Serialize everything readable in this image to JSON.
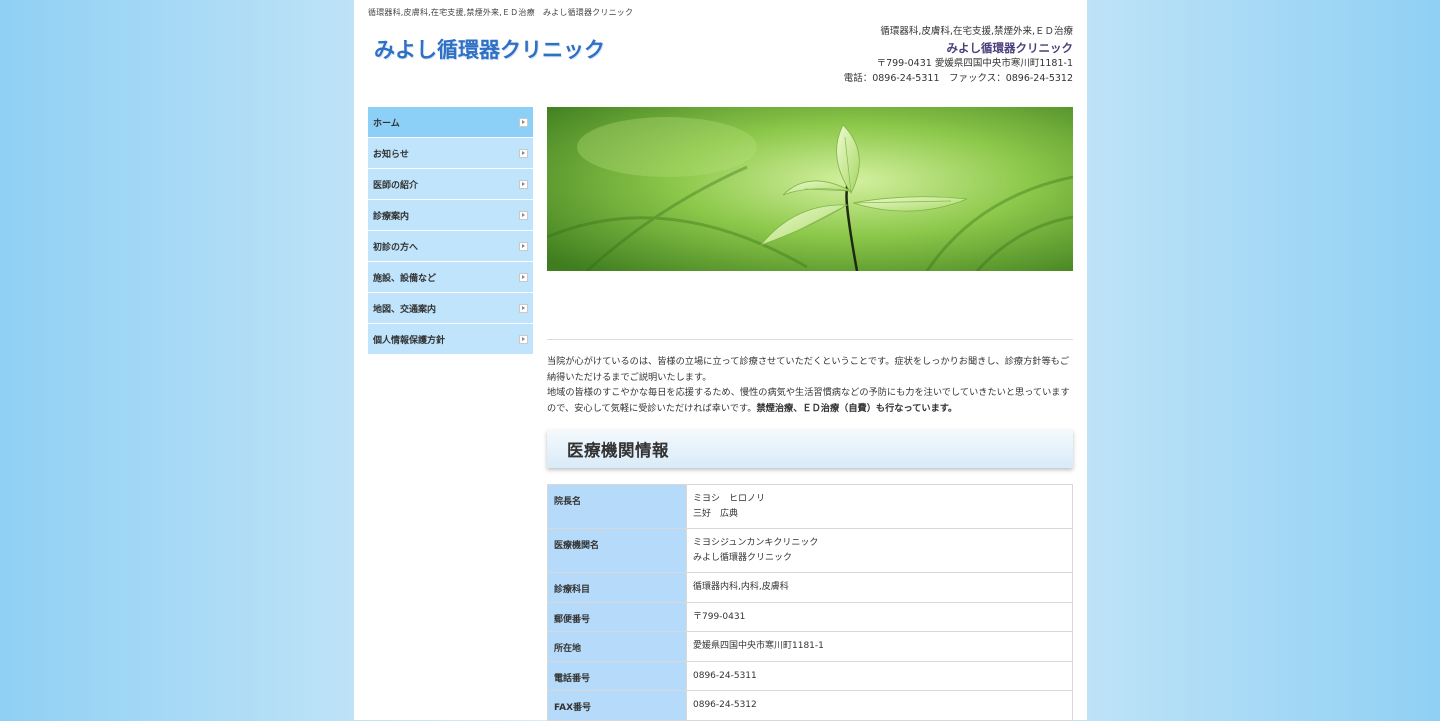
{
  "header": {
    "topline": "循環器科,皮膚科,在宅支援,禁煙外来,ＥＤ治療　みよし循環器クリニック",
    "logo": "みよし循環器クリニック",
    "right_line1": "循環器科,皮膚科,在宅支援,禁煙外来,ＥＤ治療",
    "right_clinic_name": "みよし循環器クリニック",
    "right_address": "〒799-0431 愛媛県四国中央市寒川町1181-1",
    "right_phone": "電話：0896-24-5311　ファックス：0896-24-5312"
  },
  "sidebar": {
    "items": [
      {
        "label": "ホーム"
      },
      {
        "label": "お知らせ"
      },
      {
        "label": "医師の紹介"
      },
      {
        "label": "診療案内"
      },
      {
        "label": "初診の方へ"
      },
      {
        "label": "施設、設備など"
      },
      {
        "label": "地図、交通案内"
      },
      {
        "label": "個人情報保護方針"
      }
    ]
  },
  "main": {
    "intro_1": "当院が心がけているのは、皆様の立場に立って診療させていただくということです。症状をしっかりお聞きし、診療方針等もご納得いただけるまでご説明いたします。",
    "intro_2": "地域の皆様のすこやかな毎日を応援するため、慢性の病気や生活習慣病などの予防にも力を注いでしていきたいと思っていますので、安心して気軽に受診いただければ幸いです。",
    "intro_2_bold": "禁煙治療、ＥＤ治療（自費）も行なっています。",
    "section_title": "医療機関情報",
    "table": [
      {
        "label": "院長名",
        "line1": "ミヨシ　ヒロノリ",
        "line2": "三好　広典"
      },
      {
        "label": "医療機関名",
        "line1": "ミヨシジュンカンキクリニック",
        "line2": "みよし循環器クリニック"
      },
      {
        "label": "診療科目",
        "line1": "循環器内科,内科,皮膚科",
        "line2": ""
      },
      {
        "label": "郵便番号",
        "line1": "〒799-0431",
        "line2": ""
      },
      {
        "label": "所在地",
        "line1": "愛媛県四国中央市寒川町1181-1",
        "line2": ""
      },
      {
        "label": "電話番号",
        "line1": "0896-24-5311",
        "line2": ""
      },
      {
        "label": "FAX番号",
        "line1": "0896-24-5312",
        "line2": ""
      }
    ]
  },
  "colors": {
    "nav_bg": "#bfe4fb",
    "nav_active_bg": "#8ccff7",
    "table_header_bg": "#b6dbfa",
    "logo_blue": "#2f6fc4",
    "clinic_name_purple": "#4b3d7a"
  },
  "icons": {
    "nav_arrow": "arrow-right-icon"
  }
}
